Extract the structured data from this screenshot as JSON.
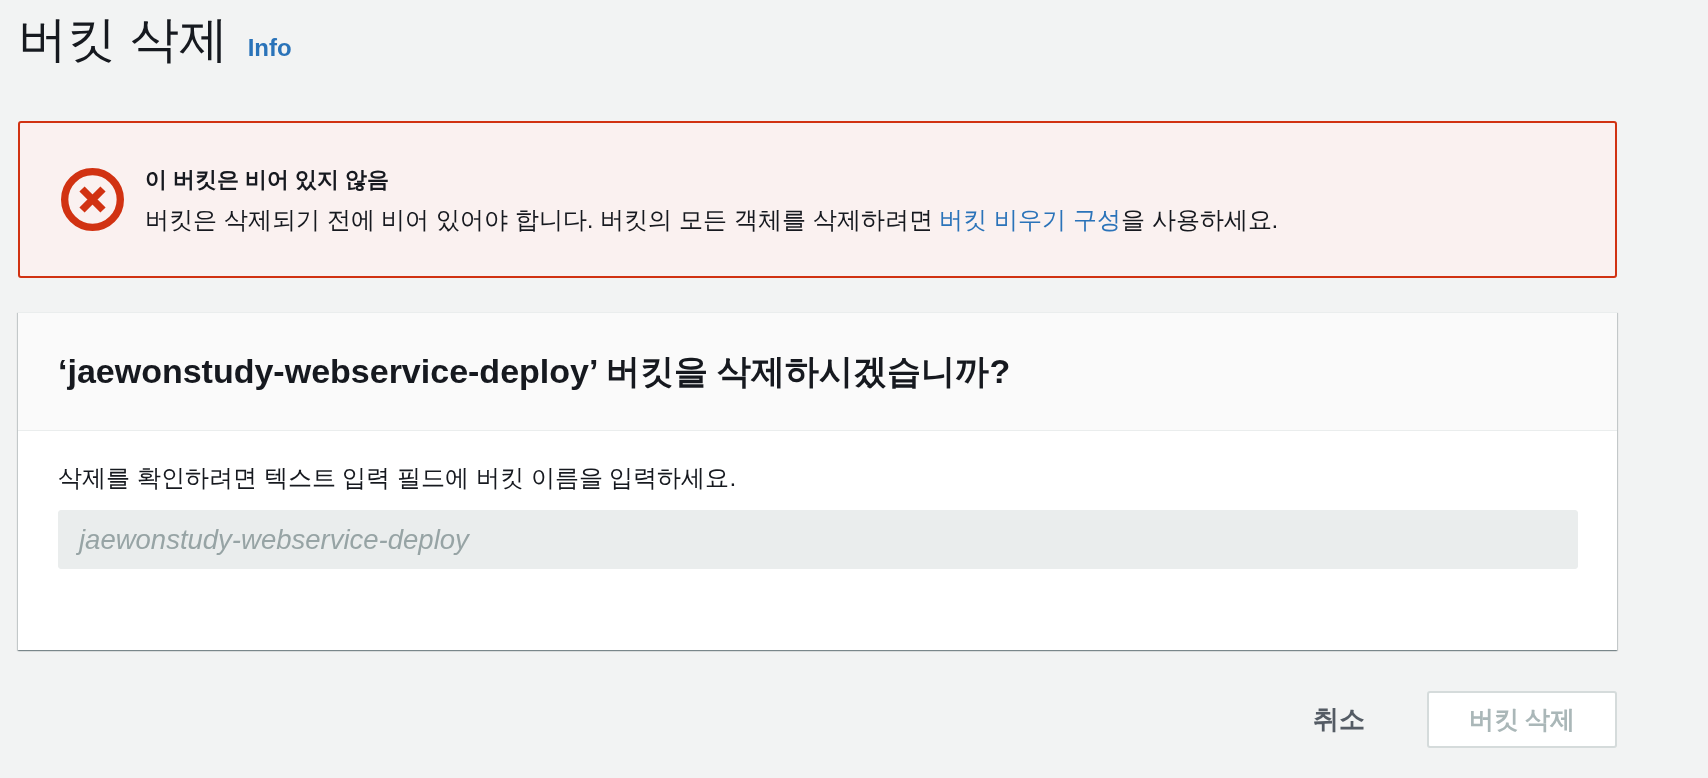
{
  "header": {
    "title": "버킷 삭제",
    "info_link": "Info"
  },
  "alert": {
    "title": "이 버킷은 비어 있지 않음",
    "message": "버킷은 삭제되기 전에 비어 있어야 합니다. 버킷의 모든 객체를 삭제하려면 ",
    "link": "버킷 비우기 구성",
    "message_end": "을 사용하세요."
  },
  "confirm_panel": {
    "title": "‘jaewonstudy-webservice-deploy’ 버킷을 삭제하시겠습니까?",
    "instruction": "삭제를 확인하려면 텍스트 입력 필드에 버킷 이름을 입력하세요.",
    "input": {
      "placeholder": "jaewonstudy-webservice-deploy",
      "disabled": true
    }
  },
  "buttons": [
    {
      "label": "취소",
      "kind": "link",
      "disabled": false
    },
    {
      "label": "버킷 삭제",
      "kind": "primary",
      "disabled": true
    }
  ]
}
